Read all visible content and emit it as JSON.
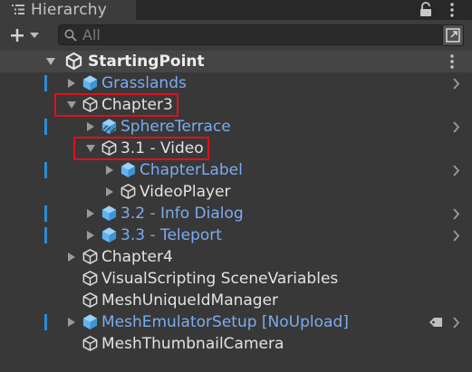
{
  "panel": {
    "title": "Hierarchy",
    "icons": {
      "tab": "hierarchy-list-icon",
      "lock": "lock-icon",
      "menu": "kebab-menu-icon"
    }
  },
  "toolbar": {
    "create_icon": "plus-dropdown-icon",
    "search_placeholder": "All",
    "search_icon": "search-icon",
    "maximize_icon": "maximize-icon"
  },
  "scene": {
    "name": "StartingPoint",
    "icon": "unity-scene-icon"
  },
  "tree": [
    {
      "label": "Grasslands",
      "depth": 1,
      "expander": "collapsed",
      "icon": "prefab-icon",
      "style": "prefab",
      "prefab_bar": true,
      "open_arrow": true
    },
    {
      "label": "Chapter3",
      "depth": 1,
      "expander": "expanded",
      "icon": "gameobject-icon",
      "style": "normal",
      "highlighted": true
    },
    {
      "label": "SphereTerrace",
      "depth": 2,
      "expander": "collapsed",
      "icon": "prefab-variant-icon",
      "style": "prefab",
      "prefab_bar": true,
      "open_arrow": true
    },
    {
      "label": "3.1 - Video",
      "depth": 2,
      "expander": "expanded",
      "icon": "gameobject-icon",
      "style": "normal",
      "highlighted": true
    },
    {
      "label": "ChapterLabel",
      "depth": 3,
      "expander": "collapsed",
      "icon": "prefab-icon",
      "style": "prefab",
      "prefab_bar": true,
      "open_arrow": true
    },
    {
      "label": "VideoPlayer",
      "depth": 3,
      "expander": "collapsed",
      "icon": "gameobject-icon",
      "style": "normal"
    },
    {
      "label": "3.2 - Info Dialog",
      "depth": 2,
      "expander": "collapsed",
      "icon": "prefab-icon",
      "style": "prefab",
      "prefab_bar": true,
      "open_arrow": true
    },
    {
      "label": "3.3 - Teleport",
      "depth": 2,
      "expander": "collapsed",
      "icon": "prefab-icon",
      "style": "prefab",
      "prefab_bar": true,
      "open_arrow": true
    },
    {
      "label": "Chapter4",
      "depth": 1,
      "expander": "collapsed",
      "icon": "gameobject-icon",
      "style": "normal"
    },
    {
      "label": "VisualScripting SceneVariables",
      "depth": 1,
      "expander": "none",
      "icon": "gameobject-icon",
      "style": "normal"
    },
    {
      "label": "MeshUniqueIdManager",
      "depth": 1,
      "expander": "none",
      "icon": "gameobject-icon",
      "style": "normal"
    },
    {
      "label": "MeshEmulatorSetup [NoUpload]",
      "depth": 1,
      "expander": "collapsed",
      "icon": "prefab-icon",
      "style": "prefab",
      "prefab_bar": true,
      "open_arrow": true,
      "tag_icon": "tag-icon"
    },
    {
      "label": "MeshThumbnailCamera",
      "depth": 1,
      "expander": "none",
      "icon": "gameobject-icon",
      "style": "normal"
    }
  ],
  "colors": {
    "panel_bg": "#383838",
    "prefab_text": "#7cacf0",
    "prefab_icon": "#5fb4f0",
    "prefab_bar": "#2f8cd4",
    "highlight_box": "#e0101a"
  }
}
